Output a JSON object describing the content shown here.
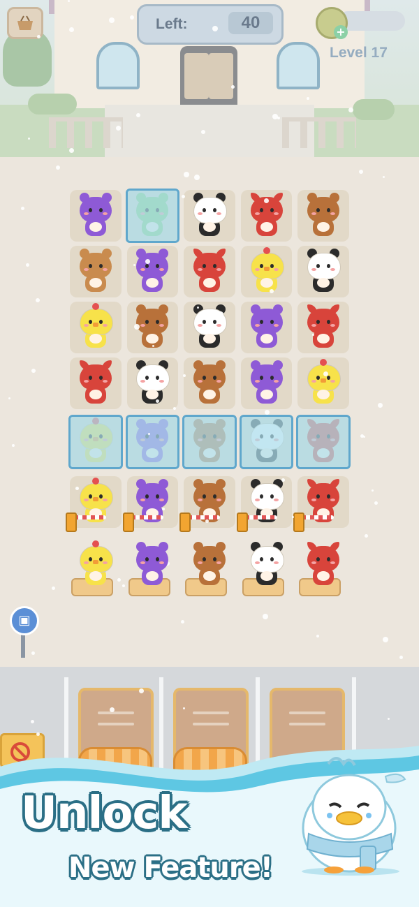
{
  "hud": {
    "left_label": "Left:",
    "left_value": "40",
    "level_label": "Level 17"
  },
  "banner": {
    "headline_line1": "Unlock",
    "headline_line2": "New Feature!"
  },
  "board": {
    "rows": [
      [
        {
          "animal": "hippo",
          "frozen": false
        },
        {
          "animal": "dino",
          "frozen": true
        },
        {
          "animal": "panda",
          "frozen": false
        },
        {
          "animal": "fox",
          "frozen": false
        },
        {
          "animal": "bear",
          "frozen": false
        }
      ],
      [
        {
          "animal": "tiger",
          "frozen": false
        },
        {
          "animal": "hippo",
          "frozen": false
        },
        {
          "animal": "fox",
          "frozen": false
        },
        {
          "animal": "chick",
          "frozen": false
        },
        {
          "animal": "panda",
          "frozen": false
        }
      ],
      [
        {
          "animal": "chick",
          "frozen": false
        },
        {
          "animal": "bear",
          "frozen": false
        },
        {
          "animal": "panda",
          "frozen": false
        },
        {
          "animal": "hippo",
          "frozen": false
        },
        {
          "animal": "fox",
          "frozen": false
        }
      ],
      [
        {
          "animal": "fox",
          "frozen": false
        },
        {
          "animal": "panda",
          "frozen": false
        },
        {
          "animal": "bear",
          "frozen": false
        },
        {
          "animal": "hippo",
          "frozen": false
        },
        {
          "animal": "chick",
          "frozen": false
        }
      ],
      [
        {
          "animal": "chick",
          "frozen": true
        },
        {
          "animal": "hippo",
          "frozen": true
        },
        {
          "animal": "bear",
          "frozen": true
        },
        {
          "animal": "panda",
          "frozen": true
        },
        {
          "animal": "fox",
          "frozen": true
        }
      ],
      [
        {
          "animal": "chick",
          "frozen": false,
          "gate": true
        },
        {
          "animal": "hippo",
          "frozen": false,
          "gate": true
        },
        {
          "animal": "bear",
          "frozen": false,
          "gate": true
        },
        {
          "animal": "panda",
          "frozen": false,
          "gate": true
        },
        {
          "animal": "fox",
          "frozen": false,
          "gate": true
        }
      ],
      [
        {
          "animal": "chick",
          "frozen": false,
          "chair": true
        },
        {
          "animal": "hippo",
          "frozen": false,
          "chair": true
        },
        {
          "animal": "bear",
          "frozen": false,
          "chair": true
        },
        {
          "animal": "panda",
          "frozen": false,
          "chair": true
        },
        {
          "animal": "fox",
          "frozen": false,
          "chair": true
        }
      ]
    ]
  },
  "palette": {
    "hippo": "#8e5ad6",
    "dino": "#8dd27a",
    "panda": "#ffffff",
    "fox": "#d8443b",
    "bear": "#b8713a",
    "tiger": "#c98b4e",
    "chick": "#f7e24a"
  },
  "icons": {
    "menu": "shop-basket-icon",
    "coin": "coin-icon",
    "add_coin": "plus-icon",
    "bus_stop": "bus-icon",
    "no_sign": "no-entry-icon",
    "mascot": "frozen-duck-mascot"
  }
}
